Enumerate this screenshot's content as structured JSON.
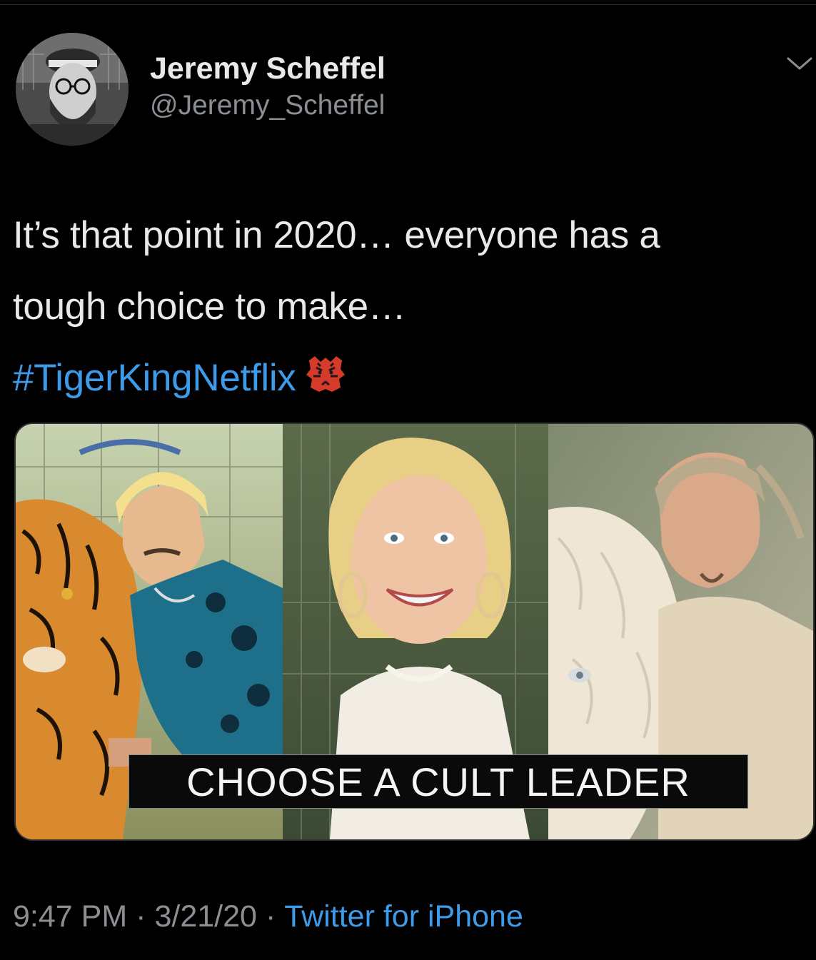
{
  "tweet": {
    "author": {
      "display_name": "Jeremy Scheffel",
      "handle": "@Jeremy_Scheffel",
      "avatar": "avatar-photo"
    },
    "menu_icon": "chevron-down-icon",
    "text_line_1": "It’s that point in 2020… everyone has a",
    "text_line_2": "tough choice to make…",
    "hashtag": "#TigerKingNetflix",
    "emoji": "tiger-face-emoji",
    "media": {
      "caption": "CHOOSE A CULT LEADER",
      "panels": [
        "man-with-tiger",
        "woman-portrait",
        "man-with-white-lion"
      ]
    },
    "meta": {
      "time": "9:47 PM",
      "date": "3/21/20",
      "separator": "·",
      "source": "Twitter for iPhone"
    }
  },
  "colors": {
    "background": "#000000",
    "primary_text": "#e7e9ea",
    "secondary_text": "#8b8f94",
    "link": "#3d9be9"
  }
}
